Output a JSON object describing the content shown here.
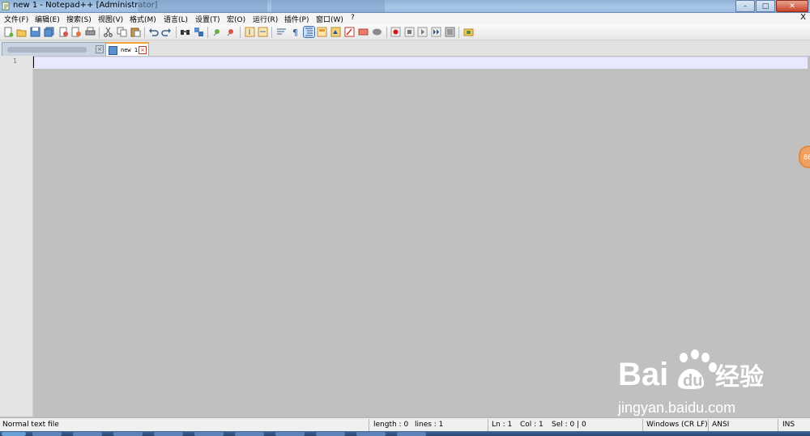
{
  "window": {
    "title": "new 1 - Notepad++ [Administrator]",
    "controls": {
      "minimize": "–",
      "maximize": "□",
      "close": "✕"
    }
  },
  "menu": {
    "items": [
      "文件(F)",
      "编辑(E)",
      "搜索(S)",
      "视图(V)",
      "格式(M)",
      "语言(L)",
      "设置(T)",
      "宏(O)",
      "运行(R)",
      "插件(P)",
      "窗口(W)",
      "?"
    ],
    "close_label": "X"
  },
  "toolbar": {
    "icons": [
      "new-file-icon",
      "open-file-icon",
      "save-icon",
      "save-all-icon",
      "close-icon",
      "close-all-icon",
      "print-icon",
      "cut-icon",
      "copy-icon",
      "paste-icon",
      "undo-icon",
      "redo-icon",
      "find-icon",
      "replace-icon",
      "zoom-in-icon",
      "zoom-out-icon",
      "sync-vertical-icon",
      "sync-horizontal-icon",
      "word-wrap-icon",
      "show-all-chars-icon",
      "indent-guide-icon",
      "user-lang-icon",
      "doc-map-icon",
      "function-list-icon",
      "folder-workspace-icon",
      "monitor-icon",
      "record-macro-icon",
      "stop-macro-icon",
      "play-macro-icon",
      "run-macro-multiple-icon",
      "save-macro-icon",
      "plugin-icon"
    ]
  },
  "tabs": [
    {
      "label": "",
      "active": false
    },
    {
      "label": "new 1",
      "active": true
    }
  ],
  "editor": {
    "line_numbers": [
      "1"
    ],
    "content": ""
  },
  "side_bubble": "86",
  "watermark": {
    "brand": "Bai du 经验",
    "url": "jingyan.baidu.com"
  },
  "status": {
    "file_type": "Normal text file",
    "length": "length : 0",
    "lines": "lines : 1",
    "ln": "Ln : 1",
    "col": "Col : 1",
    "sel": "Sel : 0 | 0",
    "eol": "Windows (CR LF)",
    "encoding": "ANSI",
    "mode": "INS"
  },
  "colors": {
    "editor_bg": "#c0c0c0",
    "current_line": "#e8e8ff",
    "active_tab_accent": "#f3a537"
  }
}
